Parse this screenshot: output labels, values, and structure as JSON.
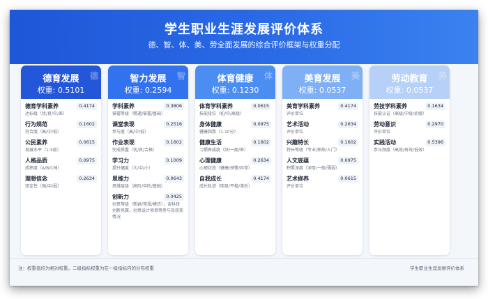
{
  "header": {
    "title": "学生职业生涯发展评价体系",
    "subtitle": "德、智、体、美、劳全面发展的综合评价框架与权重分配"
  },
  "columns": [
    {
      "name": "德育发展",
      "weight": "权重: 0.5101",
      "watermark": "德",
      "color": "#2356d8",
      "items": [
        {
          "name": "德育学科素养",
          "desc": "达标级（优/良/中/差）",
          "w": "0.4174"
        },
        {
          "name": "行为规范",
          "desc": "符合度（高/中/低）",
          "w": "0.1602"
        },
        {
          "name": "公民素养",
          "desc": "发展水平（1-5级）",
          "w": "0.0615"
        },
        {
          "name": "人格品质",
          "desc": "成熟度（A/B/C档）",
          "w": "0.0975"
        },
        {
          "name": "理想信念",
          "desc": "坚定性（强/中/弱）",
          "w": "0.2634"
        }
      ]
    },
    {
      "name": "智力发展",
      "weight": "权重: 0.2594",
      "watermark": "智",
      "color": "#3372ee",
      "items": [
        {
          "name": "学科素养",
          "desc": "掌握等级（精通/掌握/基础）",
          "w": "0.3806"
        },
        {
          "name": "课堂表现",
          "desc": "参与度（高/中/低）",
          "w": "0.2516"
        },
        {
          "name": "作业表现",
          "desc": "完成质量（优/良/合格）",
          "w": "0.1602"
        },
        {
          "name": "学习力",
          "desc": "提升幅度（大/中/小）",
          "w": "0.1009"
        },
        {
          "name": "思维力",
          "desc": "思维层级（高阶/中阶/基础）",
          "w": "0.0643"
        },
        {
          "name": "创新力",
          "desc": "创意等级（新颖/常规/模仿），含科技创新竞赛、创意设计项目等参与及获奖情况",
          "w": "0.0425"
        }
      ]
    },
    {
      "name": "体育健康",
      "weight": "权重: 0.1230",
      "watermark": "体",
      "color": "#4c8df2",
      "items": [
        {
          "name": "体育学科素养",
          "desc": "技能段位（初/中/高级）",
          "w": "0.0615"
        },
        {
          "name": "身体健康",
          "desc": "健康指数（1-10分）",
          "w": "0.0975"
        },
        {
          "name": "健康生活",
          "desc": "习惯养成度（好/一般/差）",
          "w": "0.1602"
        },
        {
          "name": "心理健康",
          "desc": "心理状态（健康/预警/异常）",
          "w": "0.2634"
        },
        {
          "name": "自我成长",
          "desc": "成长轨迹（明显/平稳/滞后）",
          "w": "0.4174"
        }
      ]
    },
    {
      "name": "美育发展",
      "weight": "权重: 0.0537",
      "watermark": "美",
      "color": "#7fb0f5",
      "items": [
        {
          "name": "美育学科素养",
          "desc": "评价单位",
          "w": "0.4174"
        },
        {
          "name": "艺术活动",
          "desc": "评价单位",
          "w": "0.2634"
        },
        {
          "name": "兴趣特长",
          "desc": "特长等级（专业/熟练/入门）",
          "w": "0.1602"
        },
        {
          "name": "人文底蕴",
          "desc": "积累深度（深厚/一般/薄弱）",
          "w": "0.0975"
        },
        {
          "name": "艺术修养",
          "desc": "评价单位",
          "w": "0.0615"
        }
      ]
    },
    {
      "name": "劳动教育",
      "weight": "权重: 0.0537",
      "watermark": "劳",
      "color": "#b6d0f7",
      "items": [
        {
          "name": "劳技学科素养",
          "desc": "技能认证（高级/中级/初级）",
          "w": "0.1634"
        },
        {
          "name": "劳动意识",
          "desc": "评价单位",
          "w": "0.2970"
        },
        {
          "name": "实践活动",
          "desc": "参与频度（高效/有效/低效）",
          "w": "0.5396"
        }
      ]
    }
  ],
  "footer": {
    "note": "注：权重值均为相对权重，二级指标权重为在一级指标内的分布权重",
    "brand": "学生职业生涯发展评价体系"
  }
}
